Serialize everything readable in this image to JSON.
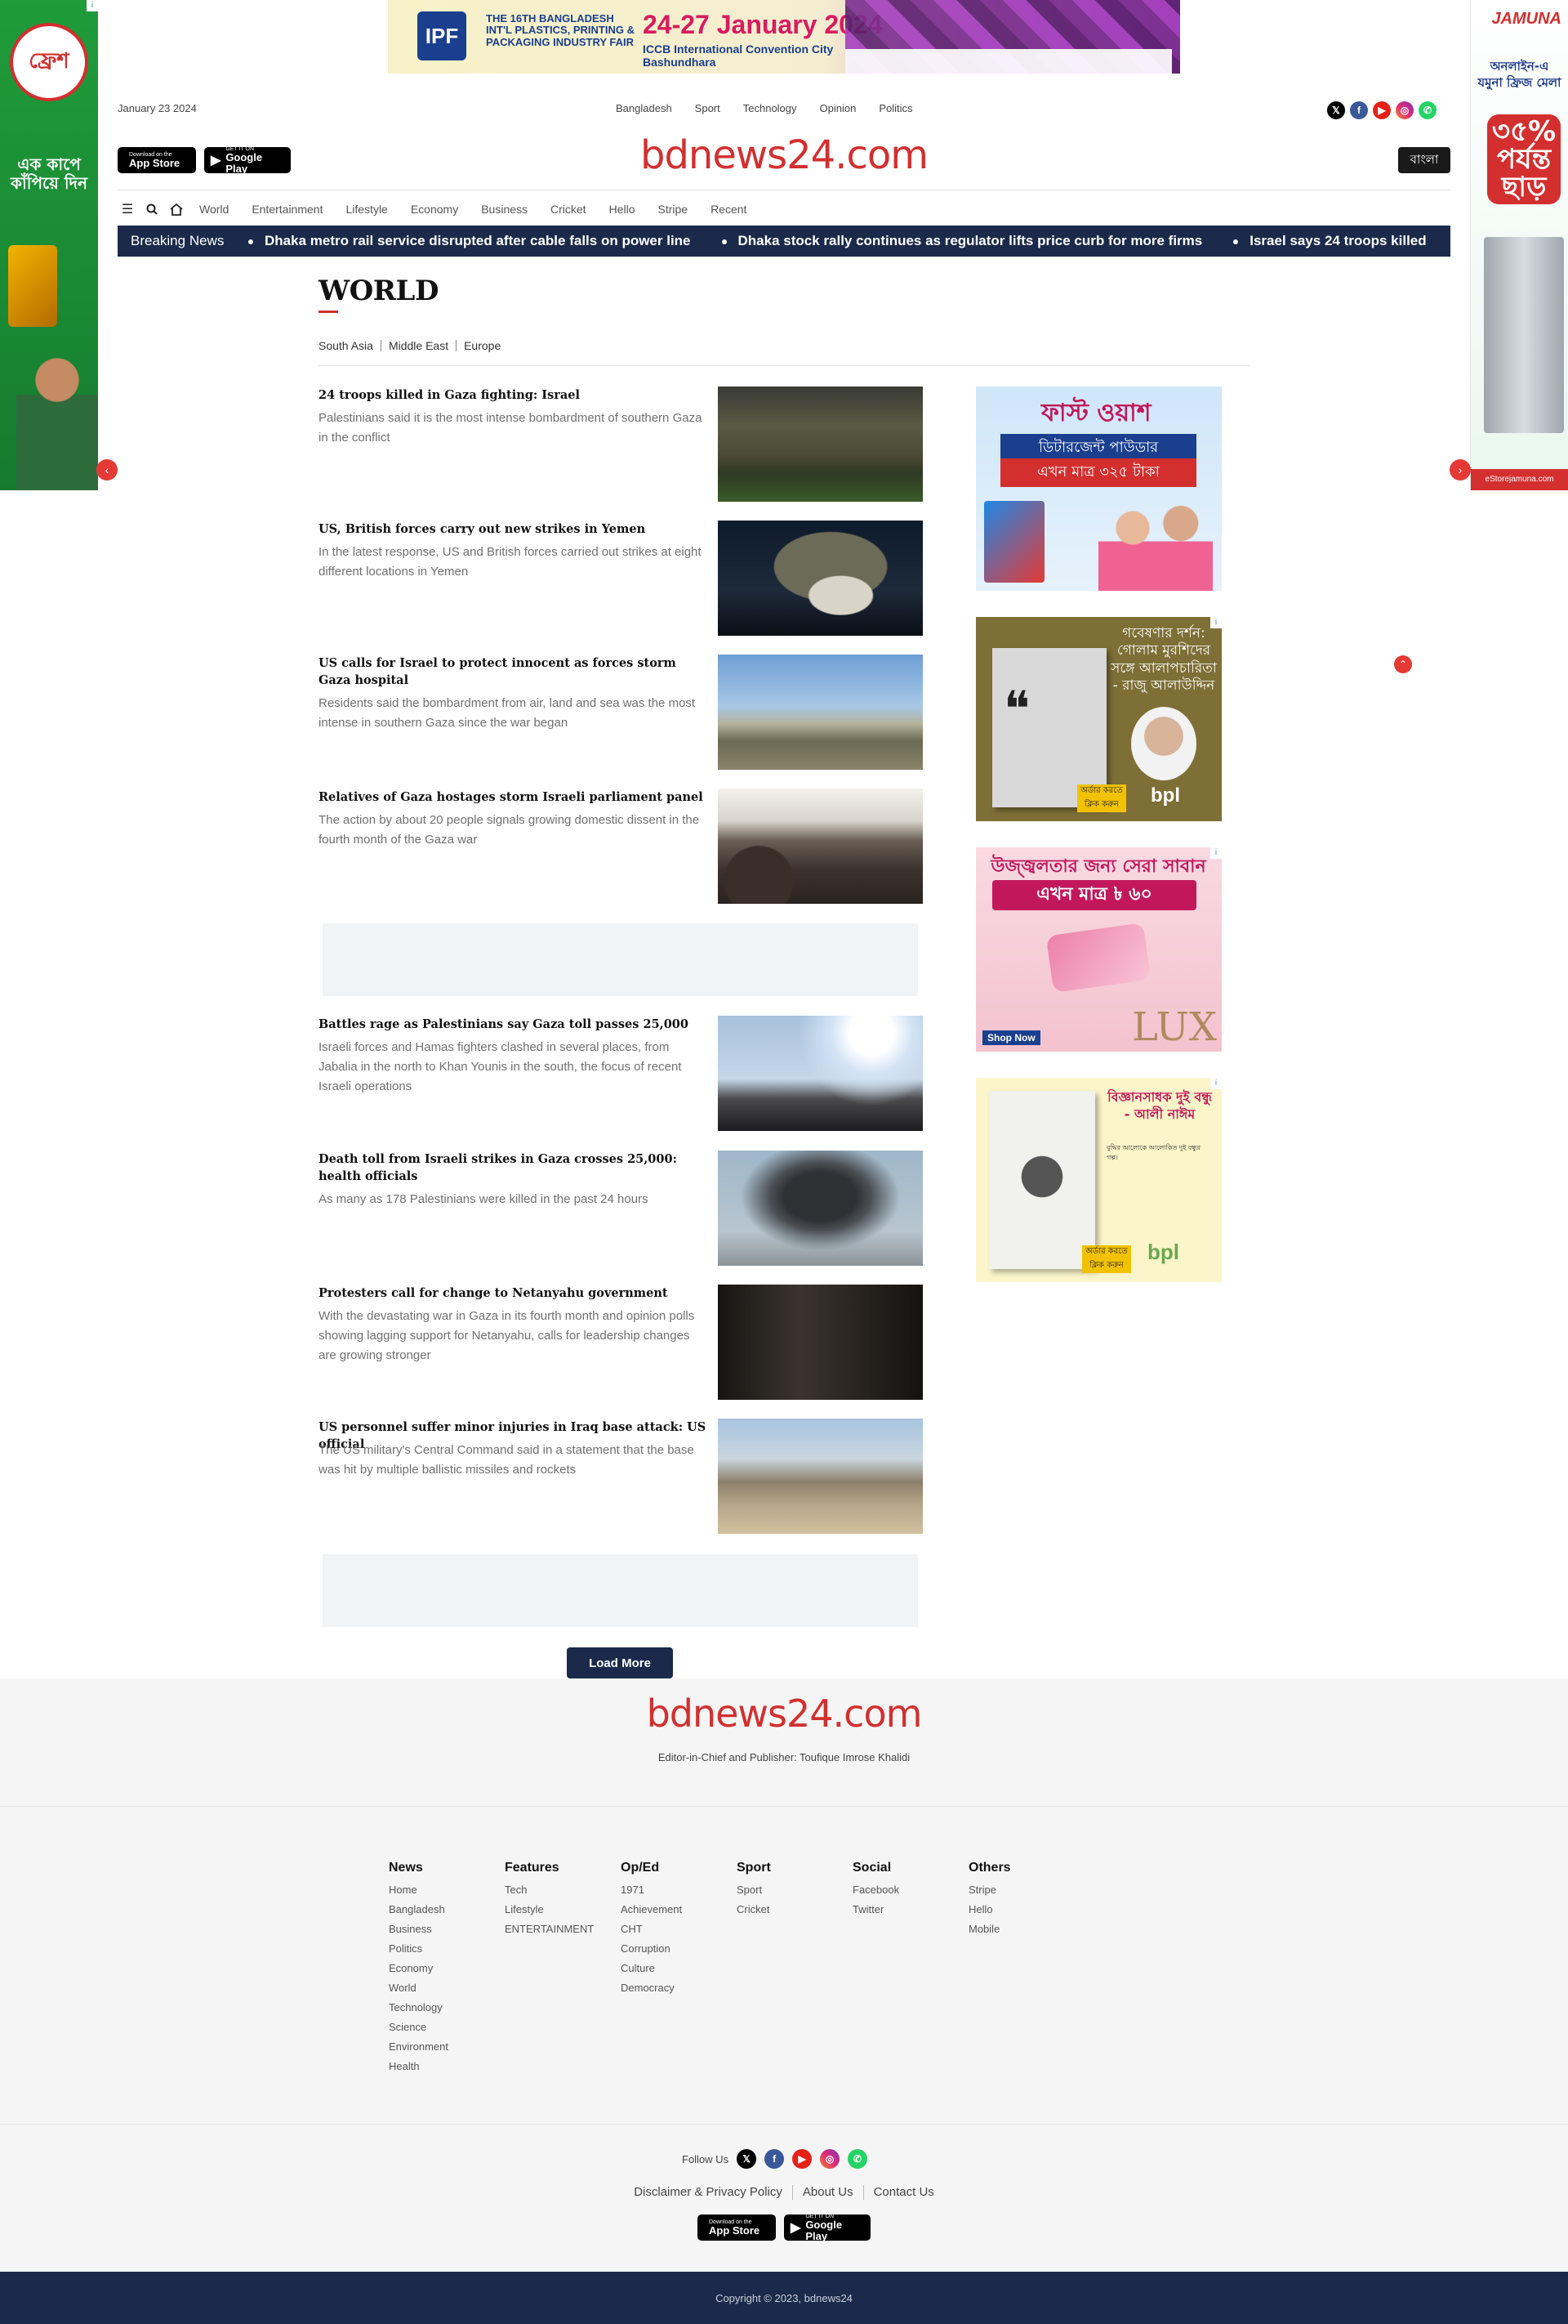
{
  "top_banner": {
    "logo": "IPF",
    "tagline": "THE 16TH BANGLADESH INT'L PLASTICS, PRINTING & PACKAGING INDUSTRY FAIR",
    "dates": "24-27 January 2024",
    "venue": "ICCB International Convention City Bashundhara"
  },
  "left_ad": {
    "brand": "ফ্রেশ",
    "slogan": "এক কাপে কাঁপিয়ে দিন"
  },
  "right_ad": {
    "brand": "JAMUNA",
    "headline": "অনলাইন-এ যমুনা ফ্রিজ মেলা",
    "discount": "৩৫% পর্যন্ত ছাড়",
    "footer": "eStorejamuna.com"
  },
  "header": {
    "date": "January 23 2024",
    "top_links": [
      "Bangladesh",
      "Sport",
      "Technology",
      "Opinion",
      "Politics"
    ],
    "logo_text": "bdnews24.com",
    "language_button": "বাংলা",
    "app_store": {
      "small": "Download on the",
      "big": "App Store"
    },
    "google_play": {
      "small": "GET IT ON",
      "big": "Google Play"
    }
  },
  "nav": {
    "items": [
      "World",
      "Entertainment",
      "Lifestyle",
      "Economy",
      "Business",
      "Cricket",
      "Hello",
      "Stripe",
      "Recent"
    ]
  },
  "breaking": {
    "label": "Breaking News",
    "items": [
      "Dhaka metro rail service disrupted after cable falls on power line",
      "Dhaka stock rally continues as regulator lifts price curb for more firms",
      "Israel says 24 troops killed"
    ]
  },
  "section": {
    "title": "WORLD",
    "subnav": [
      "South Asia",
      "Middle East",
      "Europe"
    ]
  },
  "articles": [
    {
      "headline": "24 troops killed in Gaza fighting: Israel",
      "summary": "Palestinians said it is the most intense bombardment of southern Gaza in the conflict"
    },
    {
      "headline": "US, British forces carry out new strikes in Yemen",
      "summary": "In the latest response, US and British forces carried out strikes at eight different locations in Yemen"
    },
    {
      "headline": "US calls for Israel to protect innocent as forces storm Gaza hospital",
      "summary": "Residents said the bombardment from air, land and sea was the most intense in southern Gaza since the war began"
    },
    {
      "headline": "Relatives of Gaza hostages storm Israeli parliament panel",
      "summary": "The action by about 20 people signals growing domestic dissent in the fourth month of the Gaza war"
    },
    {
      "headline": "Battles rage as Palestinians say Gaza toll passes 25,000",
      "summary": "Israeli forces and Hamas fighters clashed in several places, from Jabalia in the north to Khan Younis in the south, the focus of recent Israeli operations"
    },
    {
      "headline": "Death toll from Israeli strikes in Gaza crosses 25,000: health officials",
      "summary": "As many as 178 Palestinians were killed in the past 24 hours"
    },
    {
      "headline": "Protesters call for change to Netanyahu government",
      "summary": "With the devastating war in Gaza in its fourth month and opinion polls showing lagging support for Netanyahu, calls for leadership changes are growing stronger"
    },
    {
      "headline": "US personnel suffer minor injuries in Iraq base attack: US official",
      "summary": "The US military's Central Command said in a statement that the base was hit by multiple ballistic missiles and rockets"
    }
  ],
  "load_more": "Load More",
  "sidebar_ads": {
    "ad1": {
      "title": "ফাস্ট ওয়াশ",
      "line1": "ডিটারজেন্ট পাউডার",
      "line2": "এখন মাত্র ৩২৫ টাকা"
    },
    "ad2": {
      "title": "গবেষণার দর্শন: গোলাম মুরশিদের সঙ্গে আলাপচারিতা - রাজু আলাউদ্দিন",
      "brand": "bpl",
      "cta": "অর্ডার করতে ক্লিক করুন"
    },
    "ad3": {
      "line1": "উজ্জ্বলতার জন্য সেরা সাবান",
      "line2": "এখন মাত্র ৳ ৬০",
      "brand": "LUX",
      "cta": "Shop Now"
    },
    "ad4": {
      "title": "বিজ্ঞানসাধক দুই বন্ধু - আলী নাঈম",
      "body": "বুদ্ধির আলোকে আলোকিত দুই বন্ধুর গল্প।",
      "brand": "bpl",
      "cta": "অর্ডার করতে ক্লিক করুন"
    }
  },
  "footer": {
    "logo_text": "bdnews24.com",
    "editor": "Editor-in-Chief and Publisher: Toufique Imrose Khalidi",
    "columns": [
      {
        "heading": "News",
        "links": [
          "Home",
          "Bangladesh",
          "Business",
          "Politics",
          "Economy",
          "World",
          "Technology",
          "Science",
          "Environment",
          "Health"
        ]
      },
      {
        "heading": "Features",
        "links": [
          "Tech",
          "Lifestyle",
          "ENTERTAINMENT"
        ]
      },
      {
        "heading": "Op/Ed",
        "links": [
          "1971",
          "Achievement",
          "CHT",
          "Corruption",
          "Culture",
          "Democracy"
        ]
      },
      {
        "heading": "Sport",
        "links": [
          "Sport",
          "Cricket"
        ]
      },
      {
        "heading": "Social",
        "links": [
          "Facebook",
          "Twitter"
        ]
      },
      {
        "heading": "Others",
        "links": [
          "Stripe",
          "Hello",
          "Mobile"
        ]
      }
    ],
    "follow_label": "Follow Us",
    "legal_links": [
      "Disclaimer & Privacy Policy",
      "About Us",
      "Contact Us"
    ],
    "copyright": "Copyright © 2023, bdnews24"
  },
  "colors": {
    "brand_red": "#d32f2f",
    "navy": "#1b2a4a"
  }
}
